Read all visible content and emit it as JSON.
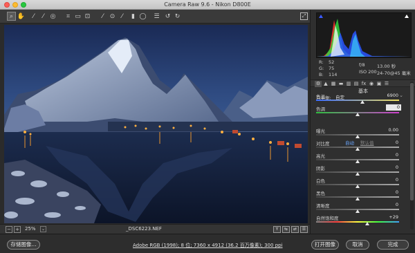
{
  "window": {
    "title": "Camera Raw 9.6  -  Nikon D800E"
  },
  "toolbar": {
    "tools": [
      {
        "name": "zoom-tool-icon",
        "glyph": "⌕"
      },
      {
        "name": "hand-tool-icon",
        "glyph": "✋"
      },
      {
        "name": "white-balance-tool-icon",
        "glyph": "⁄"
      },
      {
        "name": "color-sampler-tool-icon",
        "glyph": "⁄"
      },
      {
        "name": "targeted-adjustment-tool-icon",
        "glyph": "◎"
      },
      {
        "name": "crop-tool-icon",
        "glyph": "⌗"
      },
      {
        "name": "straighten-tool-icon",
        "glyph": "▭"
      },
      {
        "name": "transform-tool-icon",
        "glyph": "⊡"
      },
      {
        "name": "spot-removal-tool-icon",
        "glyph": "⁄"
      },
      {
        "name": "red-eye-tool-icon",
        "glyph": "⊙"
      },
      {
        "name": "adjustment-brush-icon",
        "glyph": "⁄"
      },
      {
        "name": "graduated-filter-icon",
        "glyph": "▮"
      },
      {
        "name": "radial-filter-icon",
        "glyph": "◯"
      },
      {
        "name": "preferences-icon",
        "glyph": "☰"
      },
      {
        "name": "rotate-left-icon",
        "glyph": "↺"
      },
      {
        "name": "rotate-right-icon",
        "glyph": "↻"
      }
    ]
  },
  "bottombar": {
    "zoom_level": "25%",
    "filename": "_DSC6223.NEF",
    "zoom_out_glyph": "−",
    "zoom_in_glyph": "+",
    "dropdown_glyph": "⌄",
    "view_y_label": "Y",
    "view_buttons": [
      "⇆",
      "⇄",
      "☰"
    ]
  },
  "footer": {
    "save_button": "存储图像...",
    "workflow_link": "Adobe RGB (1998); 8 位; 7360 x 4912 (36.2 百万像素); 300 ppi",
    "open_button": "打开图像",
    "cancel_button": "取消",
    "done_button": "完成"
  },
  "readout": {
    "r": "R:",
    "r_val": "52",
    "g": "G:",
    "g_val": "75",
    "b": "B:",
    "b_val": "114",
    "aperture": "f/8",
    "shutter": "13.00 秒",
    "iso": "ISO 200",
    "lens": "24-70@45 毫米"
  },
  "panel": {
    "section_title": "基本",
    "white_balance_label": "白平衡:",
    "white_balance_value": "自定",
    "auto_link": "自动",
    "default_link": "默认值",
    "tabs": [
      "⚙",
      "▲",
      "▦",
      "▬",
      "▥",
      "▤",
      "fx",
      "◉",
      "▣",
      "☰"
    ],
    "sliders": [
      {
        "label": "色温",
        "value": "6900",
        "pos": 0.56,
        "track": "temp"
      },
      {
        "label": "色调",
        "value": "0",
        "pos": 0.5,
        "track": "tint",
        "editing": true
      },
      {
        "label": "曝光",
        "value": "0.00",
        "pos": 0.5,
        "track": "gray"
      },
      {
        "label": "对比度",
        "value": "0",
        "pos": 0.5,
        "track": "gray"
      },
      {
        "label": "高光",
        "value": "0",
        "pos": 0.5,
        "track": "gray"
      },
      {
        "label": "阴影",
        "value": "0",
        "pos": 0.5,
        "track": "gray"
      },
      {
        "label": "白色",
        "value": "0",
        "pos": 0.5,
        "track": "gray"
      },
      {
        "label": "黑色",
        "value": "0",
        "pos": 0.5,
        "track": "gray"
      },
      {
        "label": "清晰度",
        "value": "0",
        "pos": 0.5,
        "track": "gray"
      },
      {
        "label": "自然饱和度",
        "value": "+29",
        "pos": 0.62,
        "track": "vib"
      }
    ]
  },
  "colors": {
    "accent": "#3a5bff",
    "hist_red": "#ff3030",
    "hist_green": "#30e040",
    "hist_blue": "#2a55ff",
    "link_blue": "#6aa7ff"
  }
}
